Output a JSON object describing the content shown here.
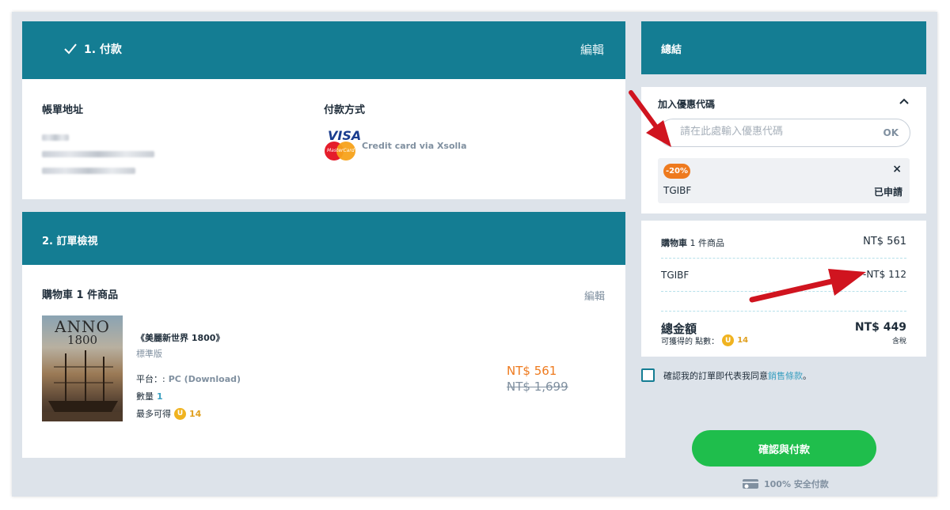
{
  "payment": {
    "title": "1. 付款",
    "edit_label": "編輯",
    "billing_label": "帳單地址",
    "method_label": "付款方式",
    "visa_text": "VISA",
    "mastercard_text": "MasterCard",
    "card_text": "Credit card via Xsolla"
  },
  "order": {
    "title": "2. 訂單檢視",
    "cart_title": "購物車 1 件商品",
    "edit_label": "編輯",
    "cover_title": "ANNO",
    "cover_year": "1800",
    "product_name": "《美麗新世界 1800》",
    "edition": "標準版",
    "platform_label": "平台：:",
    "platform_value": "PC (Download)",
    "quantity_label": "數量",
    "quantity_value": "1",
    "earn_label": "最多可得",
    "coin_symbol": "U",
    "earn_points": "14",
    "price_now": "NT$ 561",
    "price_old": "NT$ 1,699"
  },
  "summary": {
    "title": "總結",
    "promo_title": "加入優惠代碼",
    "promo_placeholder": "請在此處輸入優惠代碼",
    "promo_ok": "OK",
    "discount_badge": "-20%",
    "remove_symbol": "×",
    "applied_code": "TGIBF",
    "applied_status": "已申請",
    "cart_label_bold": "購物車",
    "cart_label_rest": " 1 件商品",
    "cart_value": "NT$ 561",
    "discount_label": "TGIBF",
    "discount_value": "-NT$ 112",
    "total_label": "總金額",
    "total_value": "NT$ 449",
    "points_label": "可獲得的 點數：",
    "points_value": "14",
    "tax_label": "含稅",
    "agree_text": "確認我的訂單即代表我同意",
    "agree_link": "銷售條款",
    "agree_end": "。",
    "pay_button": "確認與付款",
    "secure_text": "100% 安全付款"
  },
  "colors": {
    "header_teal": "#147d93",
    "accent_orange": "#ee7a1e",
    "pay_green": "#1fbe4c",
    "arrow_red": "#d0141f"
  }
}
